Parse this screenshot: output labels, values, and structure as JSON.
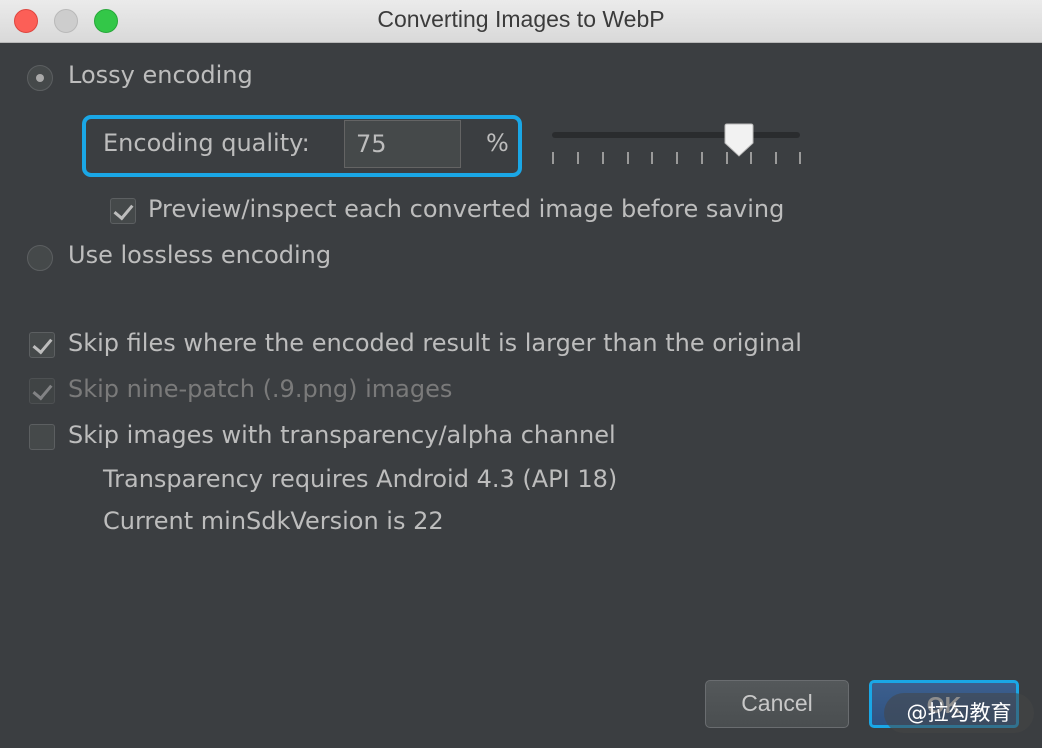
{
  "window": {
    "title": "Converting Images to WebP"
  },
  "lossy": {
    "label": "Lossy encoding",
    "selected": true
  },
  "quality": {
    "label": "Encoding quality:",
    "value": "75",
    "unit": "%",
    "slider_value": 75,
    "slider_min": 0,
    "slider_max": 100
  },
  "preview": {
    "label": "Preview/inspect each converted image before saving",
    "checked": true
  },
  "lossless": {
    "label": "Use lossless encoding",
    "selected": false
  },
  "options": {
    "skip_larger": {
      "label": "Skip files where the encoded result is larger than the original",
      "checked": true
    },
    "skip_ninepatch": {
      "label": "Skip nine-patch (.9.png) images",
      "checked": true,
      "disabled": true
    },
    "skip_transparency": {
      "label": "Skip images with transparency/alpha channel",
      "checked": false
    }
  },
  "notes": {
    "transparency_requirement": "Transparency requires Android 4.3 (API 18)",
    "min_sdk": "Current minSdkVersion is 22"
  },
  "buttons": {
    "cancel": "Cancel",
    "ok": "OK"
  },
  "watermark": "@拉勾教育",
  "colors": {
    "background": "#3b3e41",
    "focus_highlight": "#1aa7e6",
    "ok_button": "#3c5f8d"
  }
}
